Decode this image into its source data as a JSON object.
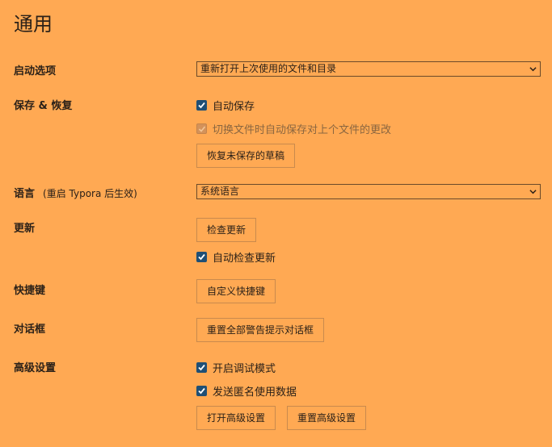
{
  "page": {
    "title": "通用"
  },
  "sections": {
    "startup": {
      "label": "启动选项",
      "select_value": "重新打开上次使用的文件和目录"
    },
    "save_restore": {
      "label": "保存 & 恢复",
      "auto_save": {
        "label": "自动保存",
        "checked": true
      },
      "switch_save": {
        "label": "切换文件时自动保存对上个文件的更改",
        "checked": true,
        "disabled": true
      },
      "restore_button": "恢复未保存的草稿"
    },
    "language": {
      "label": "语言",
      "note": "(重启 Typora 后生效)",
      "select_value": "系统语言"
    },
    "update": {
      "label": "更新",
      "check_button": "检查更新",
      "auto_check": {
        "label": "自动检查更新",
        "checked": true
      }
    },
    "shortcuts": {
      "label": "快捷键",
      "custom_button": "自定义快捷键"
    },
    "dialogs": {
      "label": "对话框",
      "reset_button": "重置全部警告提示对话框"
    },
    "advanced": {
      "label": "高级设置",
      "debug_mode": {
        "label": "开启调试模式",
        "checked": true
      },
      "send_data": {
        "label": "发送匿名使用数据",
        "checked": true
      },
      "open_button": "打开高级设置",
      "reset_button": "重置高级设置"
    }
  },
  "colors": {
    "background": "#FFA953",
    "checkbox": "#1f4f75",
    "text": "#2b2118"
  },
  "icons": {
    "select_arrow": "chevron-down-icon",
    "check": "checkmark-icon"
  }
}
